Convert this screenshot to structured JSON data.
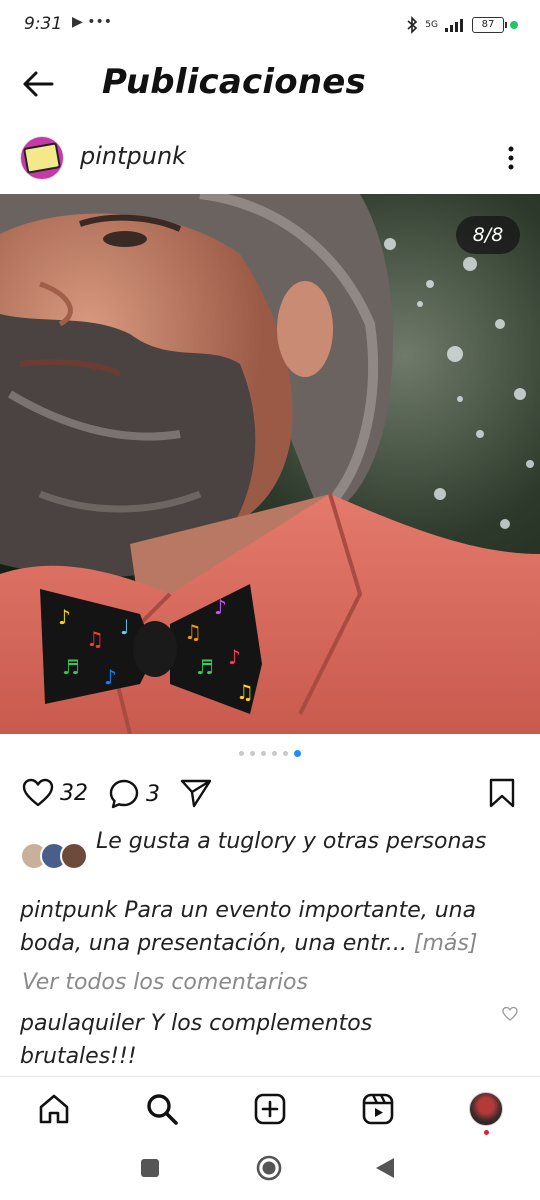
{
  "status_bar": {
    "time": "9:31",
    "left_icons": "▶ •••",
    "network": "5G",
    "battery": "87"
  },
  "header": {
    "title": "Publicaciones"
  },
  "post": {
    "username": "pintpunk",
    "counter": "8/8",
    "likes": "32",
    "comments": "3",
    "likes_text": "Le gusta a tuglory y otras personas",
    "caption_user": "pintpunk",
    "caption_text": " Para un evento importante, una boda, una presentación, una entr...",
    "caption_more": " [más]",
    "view_comments": "Ver todos los comentarios",
    "comment_user": "paulaquiler",
    "comment_text": " Y los complementos brutales!!!"
  },
  "icons": {
    "back": "arrow-left-icon",
    "more": "vertical-dots-icon",
    "like": "heart-icon",
    "comment": "chat-bubble-icon",
    "share": "paper-plane-icon",
    "save": "bookmark-icon",
    "home": "home-icon",
    "search": "search-icon",
    "create": "plus-square-icon",
    "reels": "reels-icon",
    "profile": "avatar"
  },
  "colors": {
    "accent": "#1f8ef1",
    "shirt": "#d9655a",
    "text": "#111111"
  }
}
